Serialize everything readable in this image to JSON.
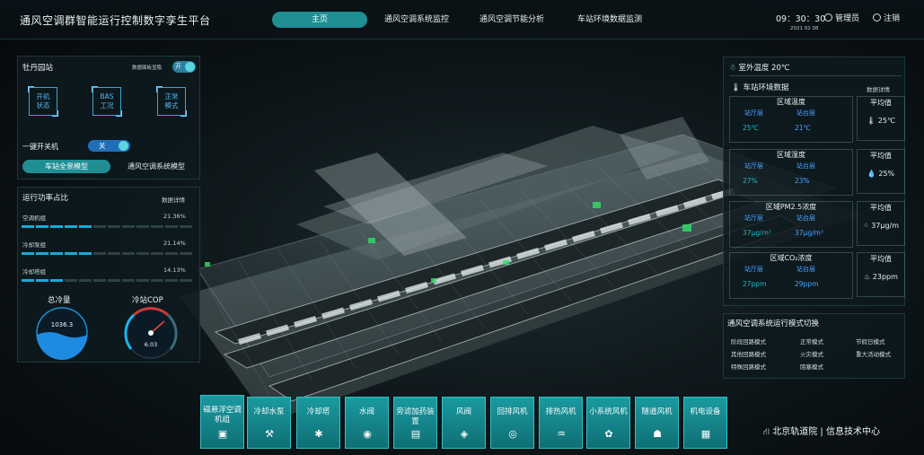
{
  "header": {
    "title": "通风空调群智能运行控制数字孪生平台",
    "nav": [
      "主页",
      "通风空调系统监控",
      "通风空调节能分析",
      "车站环境数据监测"
    ],
    "time": "09：30：30",
    "date": "2021 02 08",
    "user": "管理员",
    "logout": "注销"
  },
  "left_top": {
    "station": "牡丹园站",
    "data_toggle_label": "数据面板显隐",
    "data_toggle_state": "开",
    "buttons": [
      "开机\n状态",
      "BAS\n工况",
      "正常\n模式"
    ],
    "one_key_label": "一键开关机",
    "one_key_state": "关",
    "model_active": "车站全景模型",
    "model_other": "通风空调系统模型"
  },
  "left_bottom": {
    "title": "运行功率占比",
    "details": "数据详情",
    "rows": [
      {
        "name": "空调机组",
        "value": "21.36%",
        "fraction": 0.2136
      },
      {
        "name": "冷却泵组",
        "value": "21.14%",
        "fraction": 0.2114
      },
      {
        "name": "冷却塔组",
        "value": "14.13%",
        "fraction": 0.1413
      }
    ],
    "cooling_label": "总冷量",
    "cooling_value": "1036.3",
    "cop_label": "冷站COP",
    "cop_value": "6.03"
  },
  "right_top": {
    "outdoor": "室外温度 20℃",
    "env_title": "车站环境数据",
    "details": "数据详情",
    "rows": [
      {
        "title": "区域温度",
        "a_label": "站厅层",
        "b_label": "站台层",
        "a_val": "25℃",
        "b_val": "21℃",
        "avg_title": "平均值",
        "avg_val": "25℃",
        "avg_icon": "thermometer-icon"
      },
      {
        "title": "区域湿度",
        "a_label": "站厅层",
        "b_label": "站台层",
        "a_val": "27%",
        "b_val": "23%",
        "avg_title": "平均值",
        "avg_val": "25%",
        "avg_icon": "droplet-icon"
      },
      {
        "title": "区域PM2.5浓度",
        "a_label": "站厅层",
        "b_label": "站台层",
        "a_val": "37μg/m³",
        "b_val": "37μg/m³",
        "avg_title": "平均值",
        "avg_val": "37μg/m",
        "avg_icon": "dust-icon"
      },
      {
        "title": "区域CO₂浓度",
        "a_label": "站厅层",
        "b_label": "站台层",
        "a_val": "27ppm",
        "b_val": "29ppm",
        "avg_title": "平均值",
        "avg_val": "23ppm",
        "avg_icon": "co2-icon"
      }
    ]
  },
  "right_bottom": {
    "title": "通风空调系统运行模式切换",
    "modes": [
      "阶段回路模式",
      "正常模式",
      "节假日模式",
      "其他回路模式",
      "火灾模式",
      "重大活动模式",
      "特殊回路模式",
      "阻塞模式"
    ]
  },
  "devices": [
    "磁悬浮空调机组",
    "冷却水泵",
    "冷却塔",
    "水阀",
    "旁滤加药装置",
    "风阀",
    "回排风机",
    "排热风机",
    "小系统风机",
    "隧道风机",
    "机电设备"
  ],
  "footer": "北京轨道院 | 信息技术中心",
  "colors": {
    "accent": "#1f8f94",
    "blue": "#4aa3ff",
    "teal": "#1fb8c4"
  }
}
